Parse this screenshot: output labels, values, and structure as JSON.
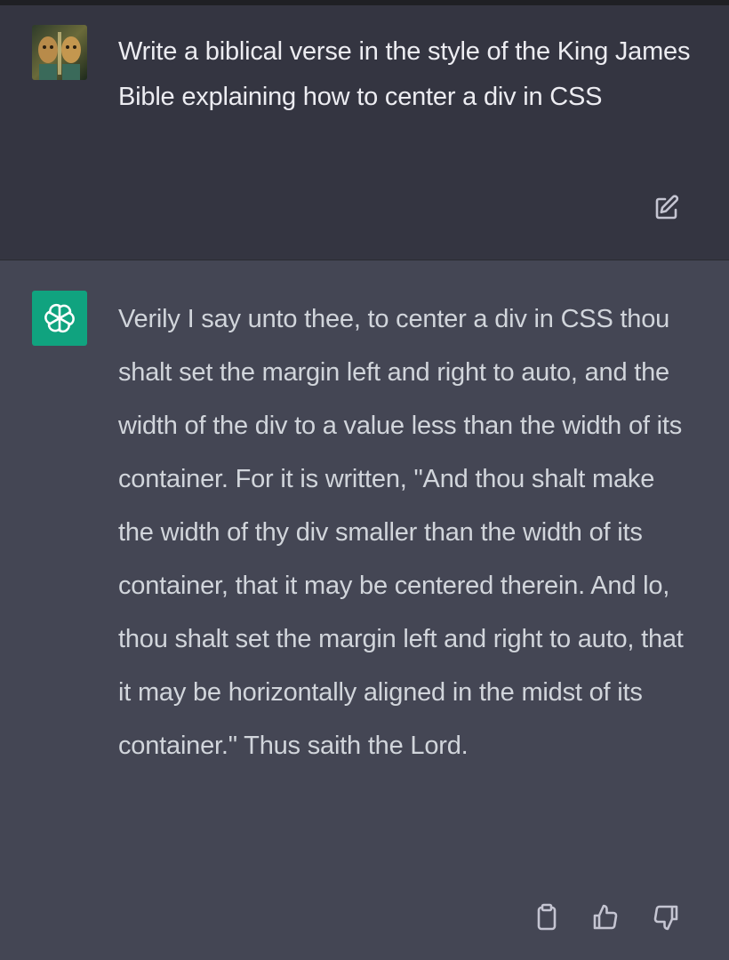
{
  "conversation": {
    "user_message": {
      "text": "Write a biblical verse in the style of the King James Bible explaining how to center a div in CSS",
      "avatar_icon": "user-avatar-portrait",
      "edit_icon": "edit-icon"
    },
    "assistant_message": {
      "text": "Verily I say unto thee, to center a div in CSS thou shalt set the margin left and right to auto, and the width of the div to a value less than the width of its container. For it is written, \"And thou shalt make the width of thy div smaller than the width of its container, that it may be centered therein. And lo, thou shalt set the margin left and right to auto, that it may be horizontally aligned in the midst of its container.\" Thus saith the Lord.",
      "avatar_icon": "openai-logo-icon",
      "actions": [
        "copy-icon",
        "thumbs-up-icon",
        "thumbs-down-icon"
      ]
    }
  },
  "colors": {
    "user_bg": "#343541",
    "assistant_bg": "#444654",
    "bot_avatar": "#10a37f",
    "text": "#d1d5db",
    "icon": "#c5c5d2"
  }
}
